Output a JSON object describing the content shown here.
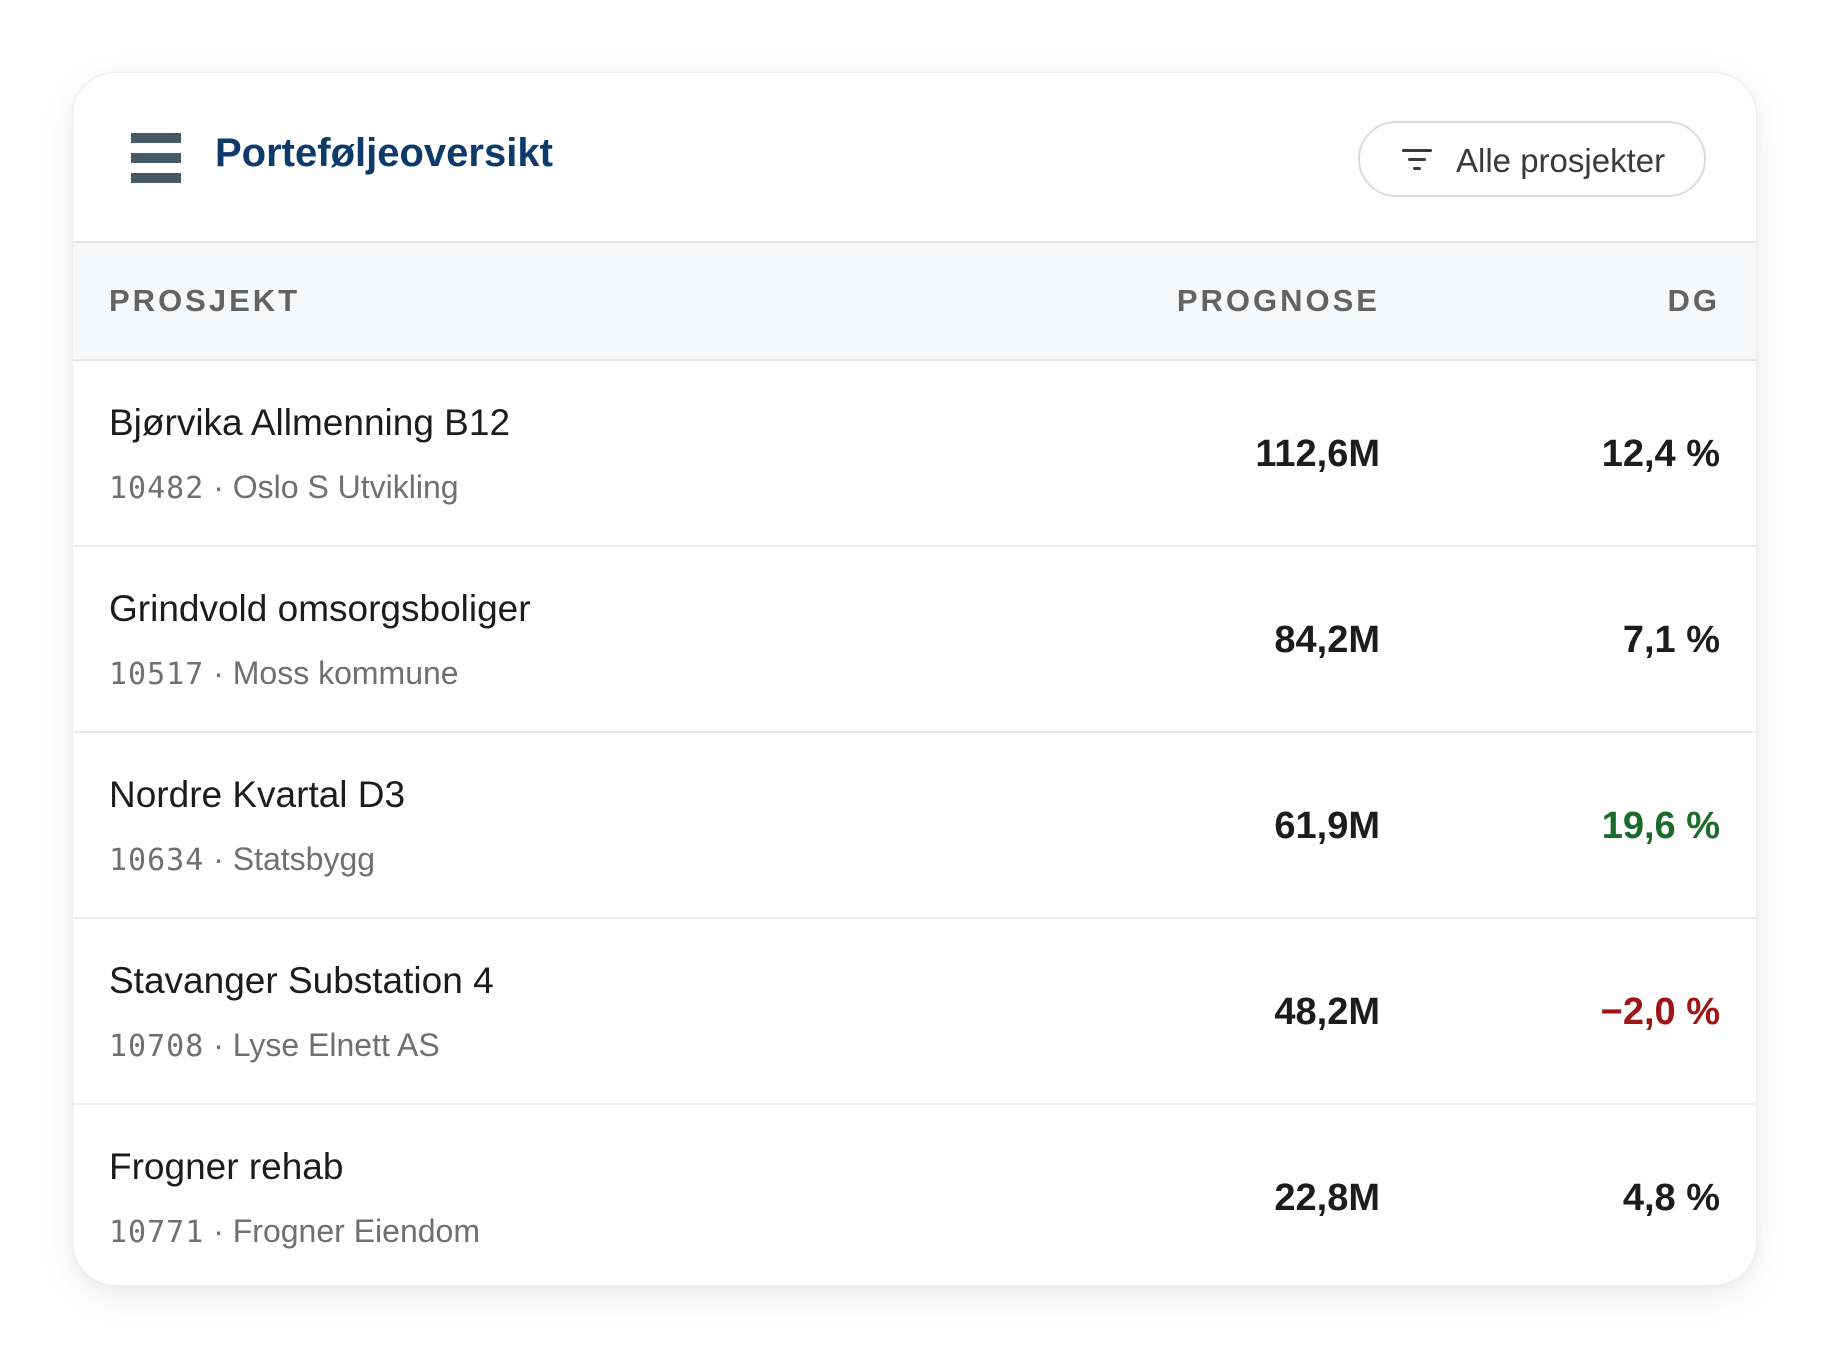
{
  "header": {
    "title": "Porteføljeoversikt",
    "filter_label": "Alle prosjekter"
  },
  "table": {
    "columns": {
      "project": "PROSJEKT",
      "prognose": "PROGNOSE",
      "dg": "DG"
    },
    "rows": [
      {
        "name": "Bjørvika Allmenning B12",
        "id": "10482",
        "separator": " · ",
        "client": "Oslo S Utvikling",
        "prognose": "112,6M",
        "dg": "12,4 %",
        "dg_status": "neutral"
      },
      {
        "name": "Grindvold omsorgsboliger",
        "id": "10517",
        "separator": " · ",
        "client": "Moss kommune",
        "prognose": "84,2M",
        "dg": "7,1 %",
        "dg_status": "neutral"
      },
      {
        "name": "Nordre Kvartal D3",
        "id": "10634",
        "separator": " · ",
        "client": "Statsbygg",
        "prognose": "61,9M",
        "dg": "19,6 %",
        "dg_status": "positive"
      },
      {
        "name": "Stavanger Substation 4",
        "id": "10708",
        "separator": " · ",
        "client": "Lyse Elnett AS",
        "prognose": "48,2M",
        "dg": "−2,0 %",
        "dg_status": "negative"
      },
      {
        "name": "Frogner rehab",
        "id": "10771",
        "separator": " · ",
        "client": "Frogner Eiendom",
        "prognose": "22,8M",
        "dg": "4,8 %",
        "dg_status": "neutral"
      }
    ]
  },
  "colors": {
    "title": "#0b3a6b",
    "icon": "#455a64",
    "positive": "#1b6b2a",
    "negative": "#9e1515"
  },
  "icons": {
    "menu": "menu-icon",
    "filter": "filter-icon"
  }
}
